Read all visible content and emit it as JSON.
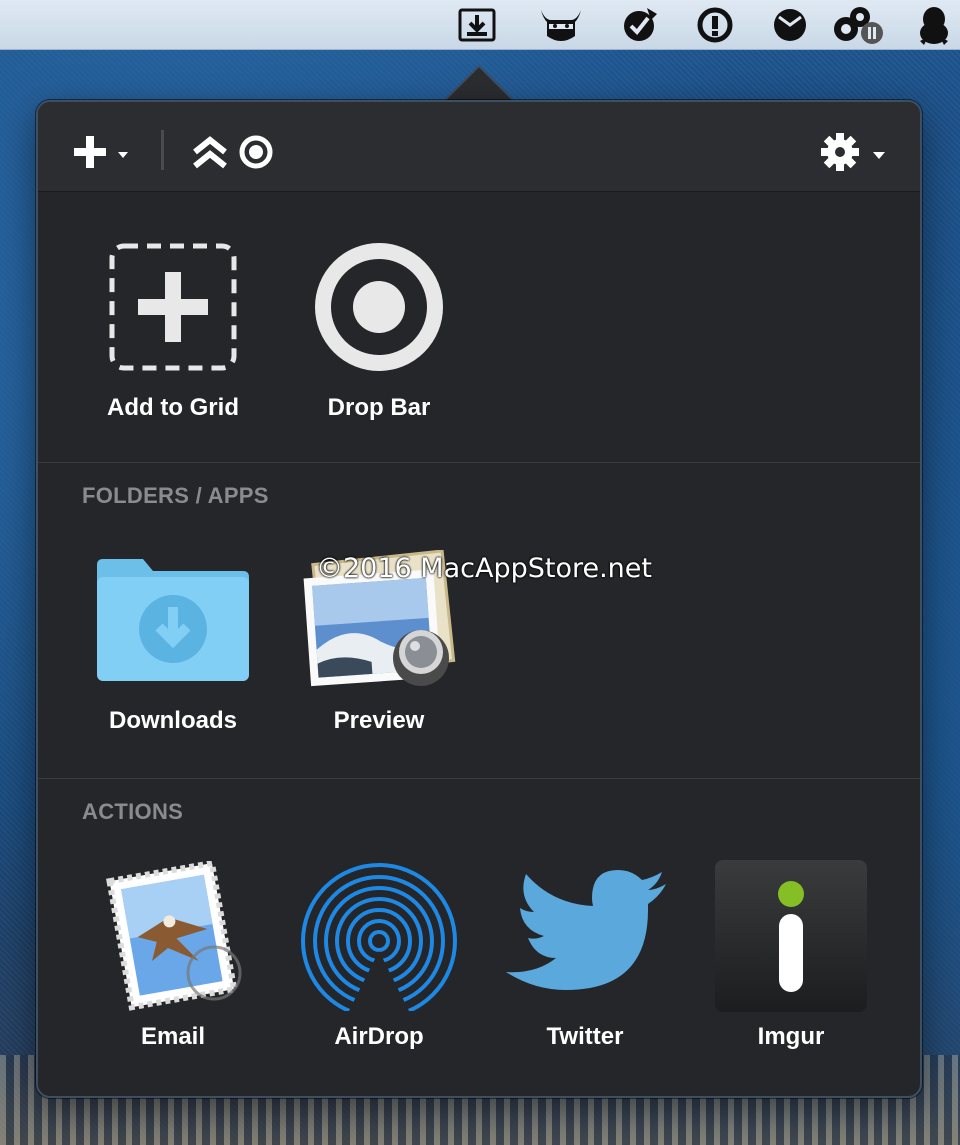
{
  "menubar": {
    "icons": [
      "dropzone-icon",
      "horned-helmet-icon",
      "checkmark-badge-icon",
      "question-circle-icon",
      "clock-icon",
      "gears-pause-icon",
      "penguin-icon"
    ]
  },
  "toolbar": {
    "add_icon": "plus-icon",
    "collapse_icon": "double-chevron-up-icon",
    "dropbar_icon": "target-icon",
    "settings_icon": "gear-icon"
  },
  "top_tiles": [
    {
      "label": "Add to Grid",
      "icon": "add-dashed-icon"
    },
    {
      "label": "Drop Bar",
      "icon": "drop-bar-icon"
    }
  ],
  "folders": {
    "title": "FOLDERS / APPS",
    "items": [
      {
        "label": "Downloads",
        "icon": "downloads-folder-icon"
      },
      {
        "label": "Preview",
        "icon": "preview-app-icon"
      }
    ]
  },
  "actions": {
    "title": "ACTIONS",
    "items": [
      {
        "label": "Email",
        "icon": "mail-stamp-icon"
      },
      {
        "label": "AirDrop",
        "icon": "airdrop-icon"
      },
      {
        "label": "Twitter",
        "icon": "twitter-bird-icon"
      },
      {
        "label": "Imgur",
        "icon": "imgur-icon"
      }
    ]
  },
  "watermark": "©2016 MacAppStore.net",
  "colors": {
    "popover_bg": "#252629",
    "toolbar_bg": "#2c2d30",
    "section_title": "#8a8b8f",
    "folder_blue": "#7fcdf5",
    "airdrop_blue": "#1e88e5",
    "twitter_blue": "#5aa8dc",
    "imgur_green": "#85bf25"
  }
}
